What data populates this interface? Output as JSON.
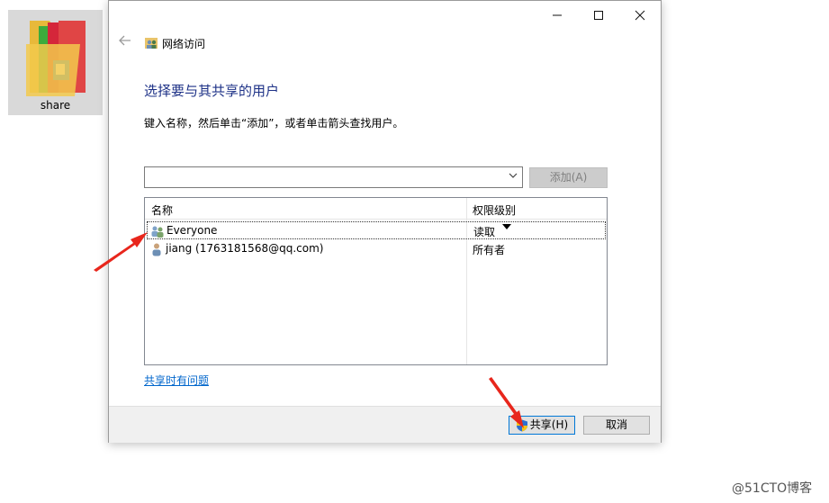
{
  "desktop": {
    "folder_label": "share"
  },
  "dialog": {
    "title": "网络访问",
    "heading": "选择要与其共享的用户",
    "instruction": "键入名称，然后单击“添加”，或者单击箭头查找用户。",
    "name_input": {
      "value": "",
      "placeholder": ""
    },
    "add_button": "添加(A)",
    "columns": {
      "name": "名称",
      "permission": "权限级别"
    },
    "rows": [
      {
        "name": "Everyone",
        "permission": "读取",
        "icon": "group-users-icon"
      },
      {
        "name": "jiang (1763181568@qq.com)",
        "permission": "所有者",
        "icon": "user-icon"
      }
    ],
    "help_link": "共享时有问题",
    "share_button": "共享(H)",
    "cancel_button": "取消"
  },
  "watermark": "@51CTO博客",
  "colors": {
    "heading": "#1e3287",
    "link": "#0066cc",
    "annotation_arrow": "#e8261c"
  }
}
